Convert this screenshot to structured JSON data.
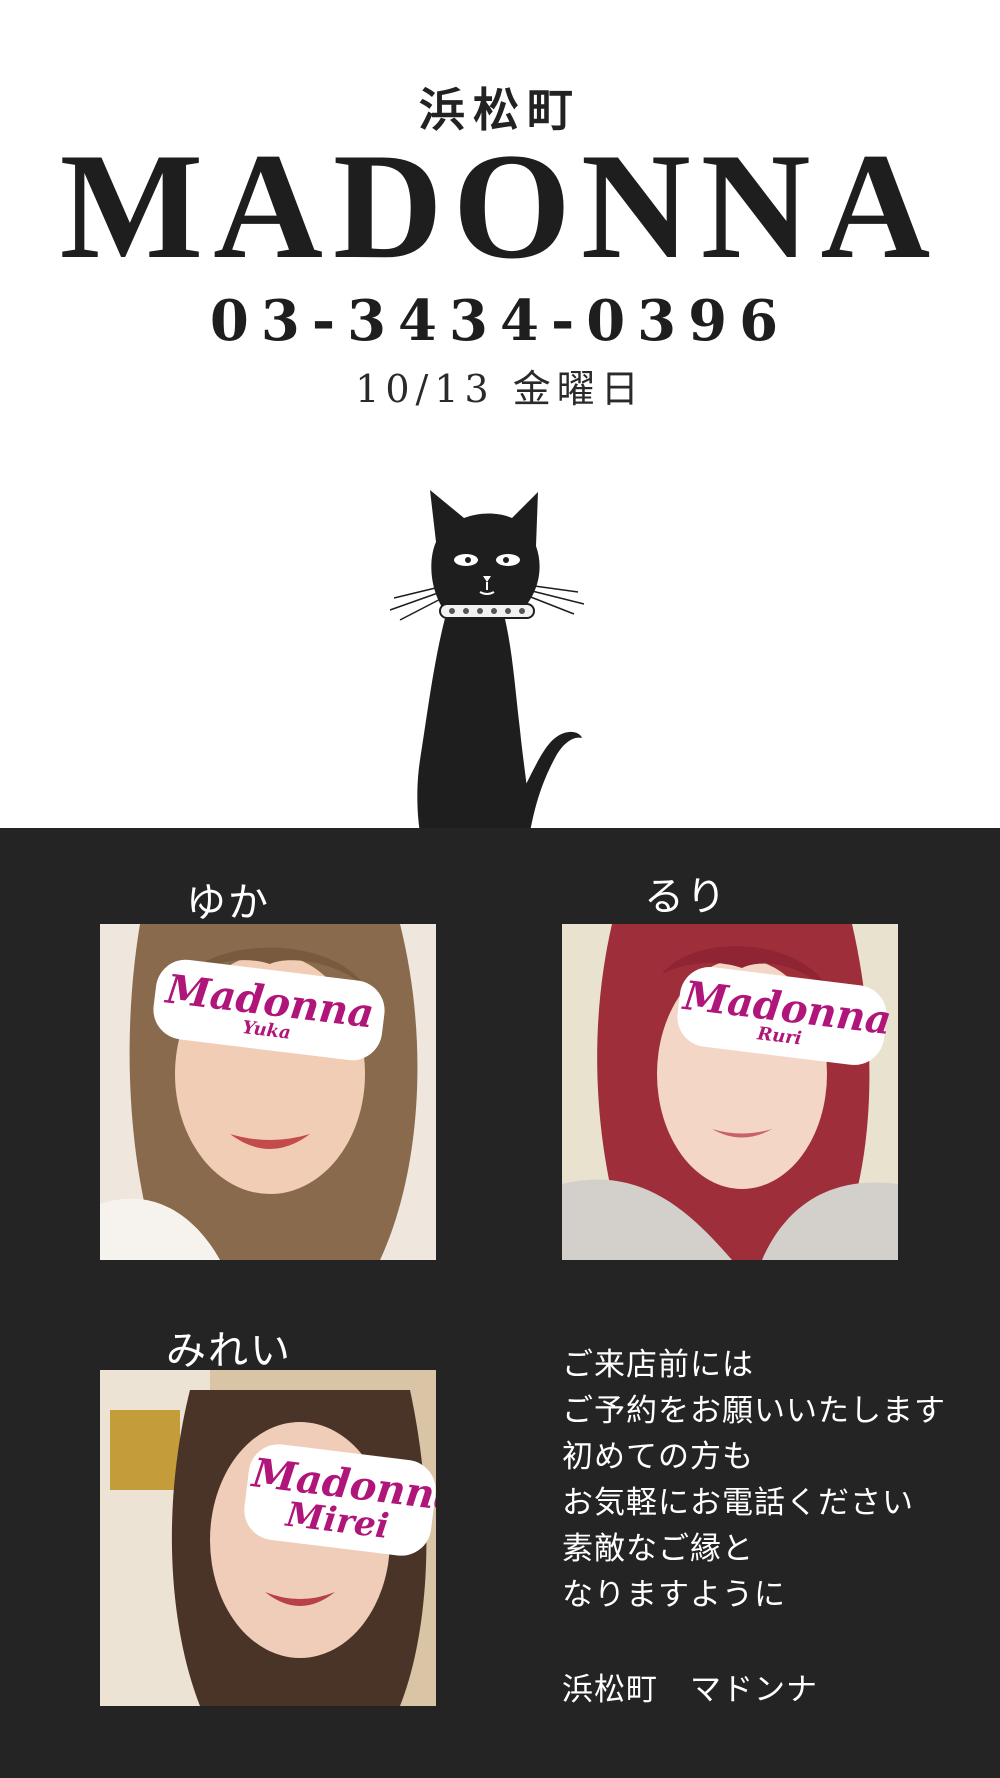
{
  "header": {
    "area": "浜松町",
    "brand": "MADONNA",
    "phone": "03-3434-0396",
    "date": "10/13 金曜日"
  },
  "cast": [
    {
      "name": "ゆか",
      "tag_logo": "Madonna",
      "tag_sub": "Yuka"
    },
    {
      "name": "るり",
      "tag_logo": "Madonna",
      "tag_sub": "Ruri"
    },
    {
      "name": "みれい",
      "tag_logo": "Madonna",
      "tag_sub": "Mirei"
    }
  ],
  "message": {
    "lines": [
      "ご来店前には",
      "ご予約をお願いいたします",
      "初めての方も",
      "お気軽にお電話ください",
      "素敵なご縁と",
      "なりますように"
    ],
    "signature": "浜松町　マドンナ"
  },
  "colors": {
    "background_top": "#ffffff",
    "background_bottom": "#242424",
    "text_dark": "#1e1e1e",
    "tag_magenta": "#b0157a"
  },
  "icons": [
    "black-cat-illustration"
  ]
}
